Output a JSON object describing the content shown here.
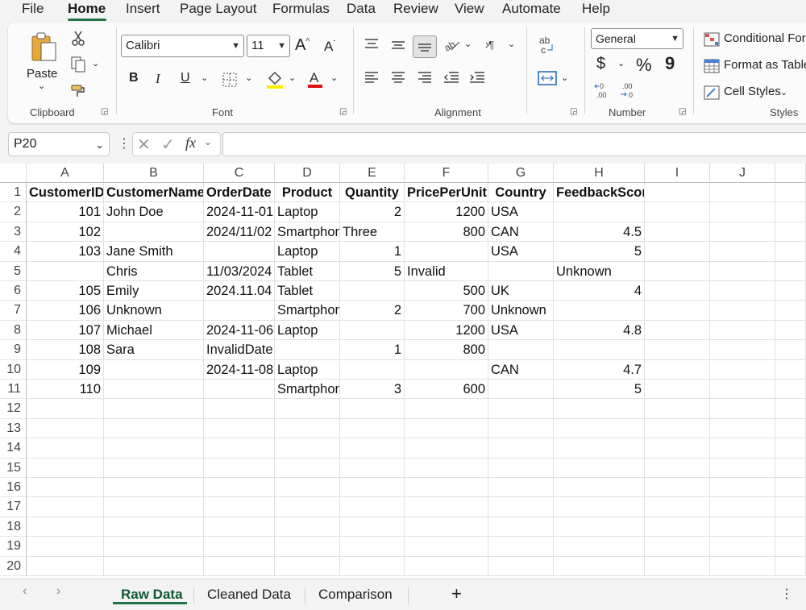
{
  "menu": {
    "file": "File",
    "home": "Home",
    "insert": "Insert",
    "page_layout": "Page Layout",
    "formulas": "Formulas",
    "data": "Data",
    "review": "Review",
    "view": "View",
    "automate": "Automate",
    "help": "Help"
  },
  "ribbon": {
    "clipboard": {
      "paste_label": "Paste",
      "group_label": "Clipboard"
    },
    "font": {
      "font_name": "Calibri",
      "font_size": "11",
      "group_label": "Font",
      "bold": "B",
      "italic": "I",
      "underline": "U"
    },
    "alignment": {
      "group_label": "Alignment"
    },
    "number": {
      "format": "General",
      "group_label": "Number",
      "currency": "$",
      "percent": "%",
      "comma": "9"
    },
    "styles": {
      "conditional": "Conditional For",
      "format_table": "Format as Table",
      "cell_styles": "Cell Styles",
      "group_label": "Styles"
    },
    "accent_color": "#217346"
  },
  "formula_bar": {
    "name_box": "P20",
    "fx": "fx",
    "formula": ""
  },
  "sheet": {
    "columns": [
      "A",
      "B",
      "C",
      "D",
      "E",
      "F",
      "G",
      "H",
      "I",
      "J"
    ],
    "row_numbers": [
      "1",
      "2",
      "3",
      "4",
      "5",
      "6",
      "7",
      "8",
      "9",
      "10",
      "11",
      "12",
      "13",
      "14",
      "15",
      "16",
      "17",
      "18",
      "19",
      "20"
    ],
    "headers": [
      "CustomerID",
      "CustomerName",
      "OrderDate",
      "Product",
      "Quantity",
      "PricePerUnit",
      "Country",
      "FeedbackScore"
    ],
    "rows": [
      [
        "101",
        "John Doe",
        "2024-11-01",
        "Laptop",
        "2",
        "1200",
        "USA",
        ""
      ],
      [
        "102",
        "",
        "2024/11/02",
        "Smartphone",
        "Three",
        "800",
        "CAN",
        "4.5"
      ],
      [
        "103",
        "Jane Smith",
        "",
        "Laptop",
        "1",
        "",
        "USA",
        "5"
      ],
      [
        "",
        "Chris",
        "11/03/2024",
        "Tablet",
        "5",
        "Invalid",
        "",
        "Unknown"
      ],
      [
        "105",
        "Emily",
        "2024.11.04",
        "Tablet",
        "",
        "500",
        "UK",
        "4"
      ],
      [
        "106",
        "Unknown",
        "",
        "Smartphone",
        "2",
        "700",
        "Unknown",
        ""
      ],
      [
        "107",
        "Michael",
        "2024-11-06",
        "Laptop",
        "",
        "1200",
        "USA",
        "4.8"
      ],
      [
        "108",
        "Sara",
        "InvalidDate",
        "",
        "1",
        "800",
        "",
        ""
      ],
      [
        "109",
        "",
        "2024-11-08",
        "Laptop",
        "",
        "",
        "CAN",
        "4.7"
      ],
      [
        "110",
        "",
        "",
        "Smartphone",
        "3",
        "600",
        "",
        "5"
      ]
    ]
  },
  "tabs": {
    "sheet1": "Raw Data",
    "sheet2": "Cleaned Data",
    "sheet3": "Comparison",
    "add": "+"
  }
}
